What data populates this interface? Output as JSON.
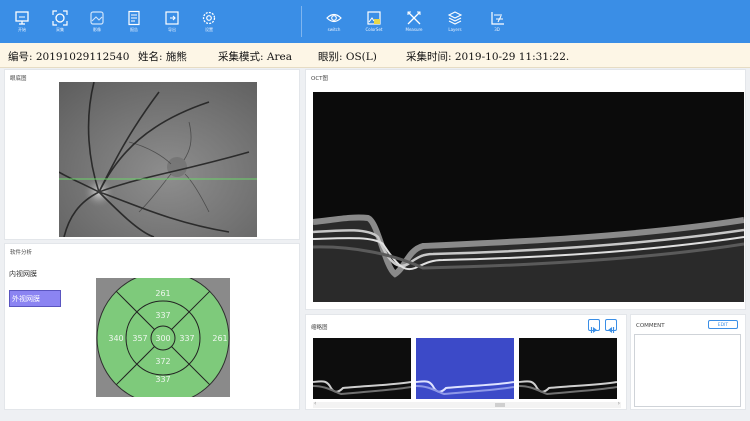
{
  "toolbar": {
    "left_buttons": [
      {
        "label": "开始",
        "icon": "monitor-icon"
      },
      {
        "label": "采集",
        "icon": "capture-icon"
      },
      {
        "label": "影像",
        "icon": "image-icon"
      },
      {
        "label": "报告",
        "icon": "report-icon"
      },
      {
        "label": "导出",
        "icon": "export-icon"
      },
      {
        "label": "设置",
        "icon": "gear-icon"
      }
    ],
    "right_buttons": [
      {
        "label": "switch",
        "icon": "eye-icon"
      },
      {
        "label": "ColorSet",
        "icon": "color-set-icon"
      },
      {
        "label": "Measure",
        "icon": "measure-icon"
      },
      {
        "label": "Layers",
        "icon": "layers-icon"
      },
      {
        "label": "3D",
        "icon": "3d-icon"
      }
    ]
  },
  "info": {
    "id": "编号: 20191029112540",
    "name": "姓名: 施熊",
    "mode": "采集模式: Area",
    "eye": "眼别: OS(L)",
    "time": "采集时间: 2019-10-29 11:31:22."
  },
  "fundus_panel": {
    "title": "眼底图"
  },
  "oct_panel": {
    "title": "OCT图"
  },
  "analysis_panel": {
    "title": "软件分析",
    "layers": [
      {
        "label": "内视网膜",
        "selected": false
      },
      {
        "label": "外视网膜",
        "selected": true
      }
    ],
    "etdrs_values": {
      "center": "300",
      "inner_top": "337",
      "inner_left": "357",
      "inner_right": "337",
      "inner_bottom": "372",
      "outer_top": "261",
      "outer_left": "340",
      "outer_right": "261",
      "outer_bottom": "337"
    }
  },
  "thumb_panel": {
    "title": "缩略图"
  },
  "comment_panel": {
    "title": "COMMENT",
    "edit_label": "EDIT"
  },
  "colors": {
    "toolbar": "#3a8ee6",
    "infobar": "#fdf6e6",
    "selected_layer": "#8b84f2",
    "etdrs_fill": "#7dd37a"
  }
}
